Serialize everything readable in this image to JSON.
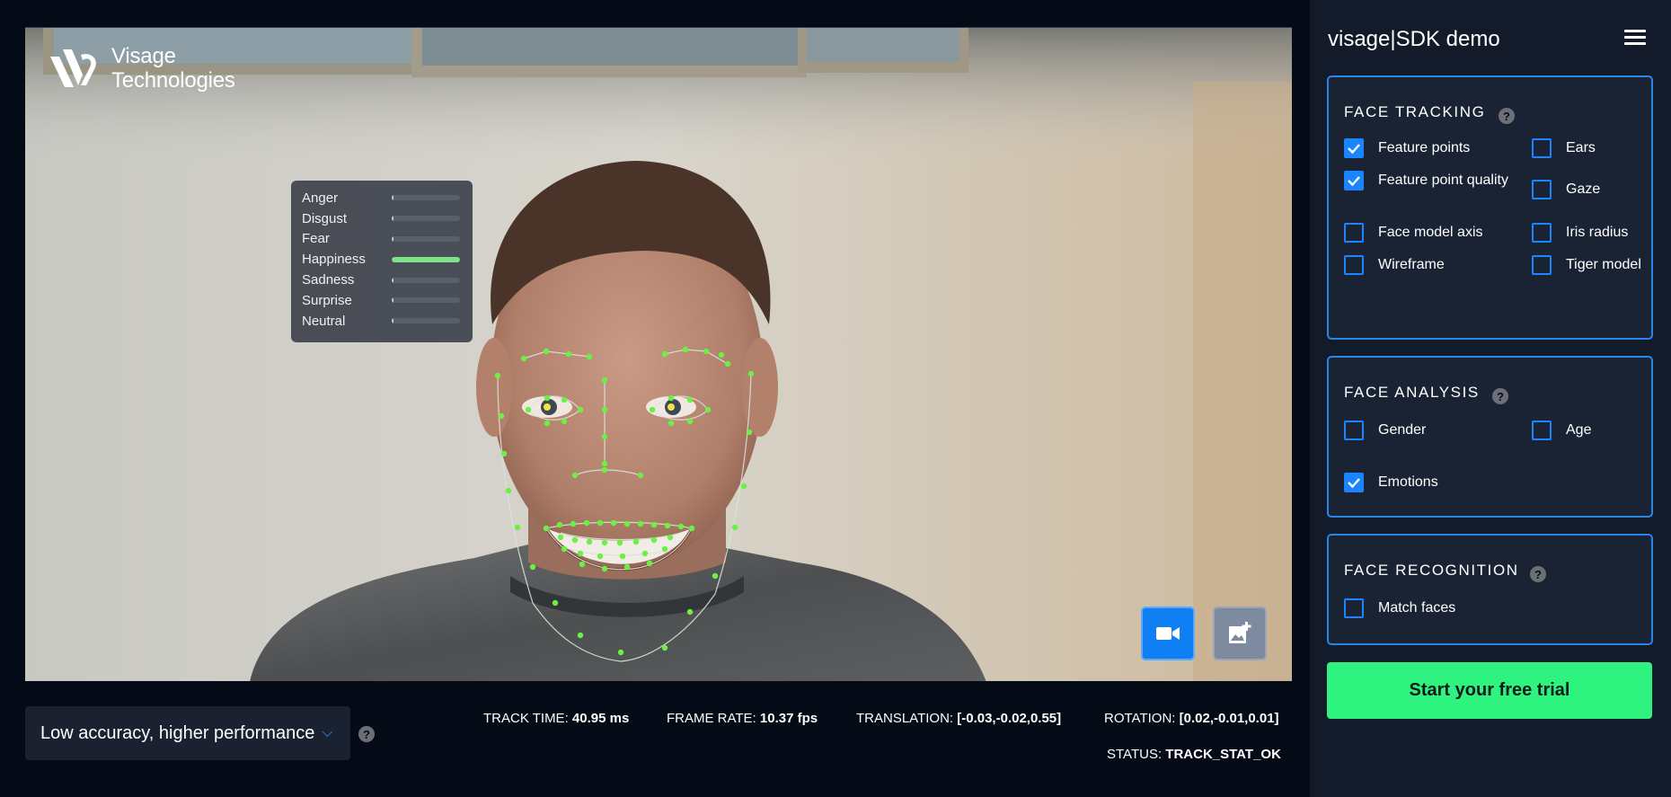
{
  "logo": {
    "line1": "Visage",
    "line2": "Technologies"
  },
  "emotions": [
    {
      "label": "Anger",
      "value": 0.0
    },
    {
      "label": "Disgust",
      "value": 0.02
    },
    {
      "label": "Fear",
      "value": 0.0
    },
    {
      "label": "Happiness",
      "value": 1.0
    },
    {
      "label": "Sadness",
      "value": 0.01
    },
    {
      "label": "Surprise",
      "value": 0.01
    },
    {
      "label": "Neutral",
      "value": 0.01
    }
  ],
  "controls": {
    "accuracy": "Low accuracy, higher performance",
    "video_button": "video-camera-icon",
    "image_button": "add-image-icon"
  },
  "stats": {
    "track_time_label": "TRACK TIME:",
    "track_time_value": "40.95 ms",
    "frame_rate_label": "FRAME RATE:",
    "frame_rate_value": "10.37 fps",
    "translation_label": "TRANSLATION:",
    "translation_value": "[-0.03,-0.02,0.55]",
    "rotation_label": "ROTATION:",
    "rotation_value": "[0.02,-0.01,0.01]",
    "status_label": "STATUS:",
    "status_value": "TRACK_STAT_OK"
  },
  "panel": {
    "title": "visage|SDK demo",
    "sections": {
      "tracking": {
        "title": "FACE TRACKING",
        "options": [
          {
            "label": "Feature points",
            "checked": true
          },
          {
            "label": "Ears",
            "checked": false
          },
          {
            "label": "Feature point quality",
            "checked": true
          },
          {
            "label": "Gaze",
            "checked": false
          },
          {
            "label": "Face model axis",
            "checked": false
          },
          {
            "label": "Iris radius",
            "checked": false
          },
          {
            "label": "Wireframe",
            "checked": false
          },
          {
            "label": "Tiger model",
            "checked": false
          }
        ]
      },
      "analysis": {
        "title": "FACE ANALYSIS",
        "options": [
          {
            "label": "Gender",
            "checked": false
          },
          {
            "label": "Age",
            "checked": false
          },
          {
            "label": "Emotions",
            "checked": true
          }
        ]
      },
      "recognition": {
        "title": "FACE RECOGNITION",
        "options": [
          {
            "label": "Match faces",
            "checked": false
          }
        ]
      }
    },
    "trial_button": "Start your free trial"
  },
  "colors": {
    "accent": "#1b84ff",
    "trial": "#2ef47f",
    "landmark": "#6cf046",
    "happiness_bar": "#7ee28a"
  }
}
